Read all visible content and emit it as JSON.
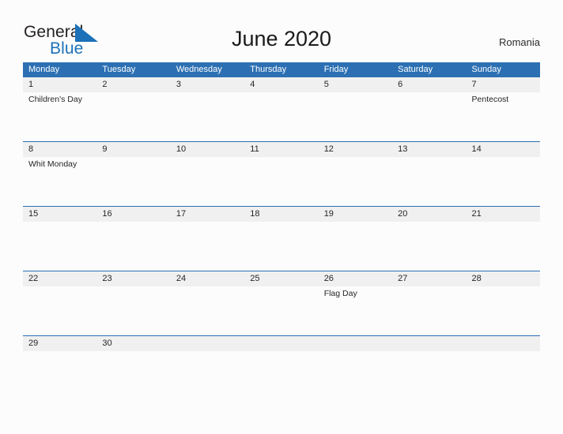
{
  "brand": {
    "name_top": "General",
    "name_bottom": "Blue",
    "color_dark": "#231f20",
    "color_blue": "#1c71b8"
  },
  "header": {
    "title": "June 2020",
    "country": "Romania"
  },
  "calendar": {
    "accent_color": "#2c70b3",
    "daynum_band_color": "#f0f0f0",
    "weekday_headers": [
      "Monday",
      "Tuesday",
      "Wednesday",
      "Thursday",
      "Friday",
      "Saturday",
      "Sunday"
    ],
    "weeks": [
      {
        "days": [
          {
            "num": "1",
            "events": [
              "Children's Day"
            ]
          },
          {
            "num": "2",
            "events": []
          },
          {
            "num": "3",
            "events": []
          },
          {
            "num": "4",
            "events": []
          },
          {
            "num": "5",
            "events": []
          },
          {
            "num": "6",
            "events": []
          },
          {
            "num": "7",
            "events": [
              "Pentecost"
            ]
          }
        ]
      },
      {
        "days": [
          {
            "num": "8",
            "events": [
              "Whit Monday"
            ]
          },
          {
            "num": "9",
            "events": []
          },
          {
            "num": "10",
            "events": []
          },
          {
            "num": "11",
            "events": []
          },
          {
            "num": "12",
            "events": []
          },
          {
            "num": "13",
            "events": []
          },
          {
            "num": "14",
            "events": []
          }
        ]
      },
      {
        "days": [
          {
            "num": "15",
            "events": []
          },
          {
            "num": "16",
            "events": []
          },
          {
            "num": "17",
            "events": []
          },
          {
            "num": "18",
            "events": []
          },
          {
            "num": "19",
            "events": []
          },
          {
            "num": "20",
            "events": []
          },
          {
            "num": "21",
            "events": []
          }
        ]
      },
      {
        "days": [
          {
            "num": "22",
            "events": []
          },
          {
            "num": "23",
            "events": []
          },
          {
            "num": "24",
            "events": []
          },
          {
            "num": "25",
            "events": []
          },
          {
            "num": "26",
            "events": [
              "Flag Day"
            ]
          },
          {
            "num": "27",
            "events": []
          },
          {
            "num": "28",
            "events": []
          }
        ]
      },
      {
        "days": [
          {
            "num": "29",
            "events": []
          },
          {
            "num": "30",
            "events": []
          },
          {
            "num": "",
            "events": []
          },
          {
            "num": "",
            "events": []
          },
          {
            "num": "",
            "events": []
          },
          {
            "num": "",
            "events": []
          },
          {
            "num": "",
            "events": []
          }
        ]
      }
    ]
  }
}
